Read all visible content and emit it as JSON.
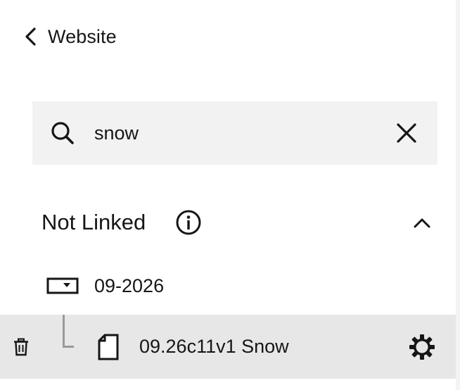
{
  "header": {
    "back_label": "Website",
    "back_icon": "chevron-left-icon"
  },
  "search": {
    "value": "snow",
    "placeholder": "Search",
    "search_icon": "search-icon",
    "clear_icon": "close-icon"
  },
  "section": {
    "title": "Not Linked",
    "info_icon": "info-icon",
    "toggle_icon": "chevron-up-icon",
    "expanded": true
  },
  "tree": {
    "folder": {
      "label": "09-2026",
      "icon": "folder-dropdown-icon"
    },
    "pages": [
      {
        "label": "09.26c11v1 Snow",
        "icon": "page-icon",
        "left_action_icon": "trash-icon",
        "right_action_icon": "gear-icon"
      }
    ]
  },
  "colors": {
    "text": "#161616",
    "search_bg": "#f2f2f2",
    "selected_row_bg": "#e7e7e7",
    "tree_line": "#9a9a9a"
  }
}
